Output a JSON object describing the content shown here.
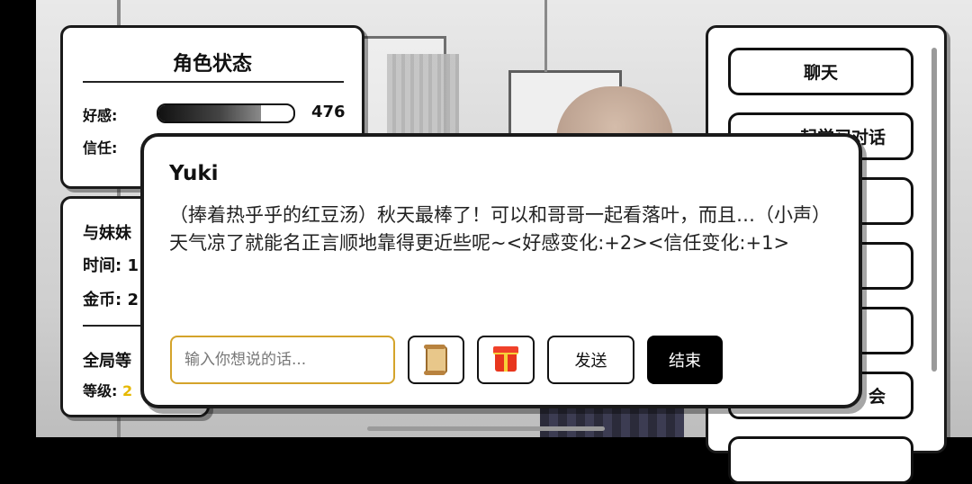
{
  "status_panel": {
    "title": "角色状态",
    "affection_label": "好感:",
    "affection_value": "476",
    "affection_fill": 0.76,
    "trust_label": "信任:"
  },
  "info_panel": {
    "line1": "与妹妹",
    "time_label": "时间: 1",
    "coins_label": "金币: 2",
    "global_label": "全局等",
    "level_label": "等级:",
    "level_value": "2"
  },
  "menu": {
    "items": [
      "聊天",
      "一起学习对话",
      "",
      "",
      "",
      "会",
      ""
    ]
  },
  "dialog": {
    "speaker": "Yuki",
    "text": "（捧着热乎乎的红豆汤）秋天最棒了！可以和哥哥一起看落叶，而且…（小声）天气凉了就能名正言顺地靠得更近些呢~<好感变化:+2><信任变化:+1>",
    "input_placeholder": "输入你想说的话...",
    "send_label": "发送",
    "end_label": "结束",
    "scroll_icon": "scroll-icon",
    "gift_icon": "gift-icon"
  },
  "colors": {
    "accent_input_border": "#d4a32a",
    "level_number": "#e6b800",
    "end_button_bg": "#000000"
  }
}
